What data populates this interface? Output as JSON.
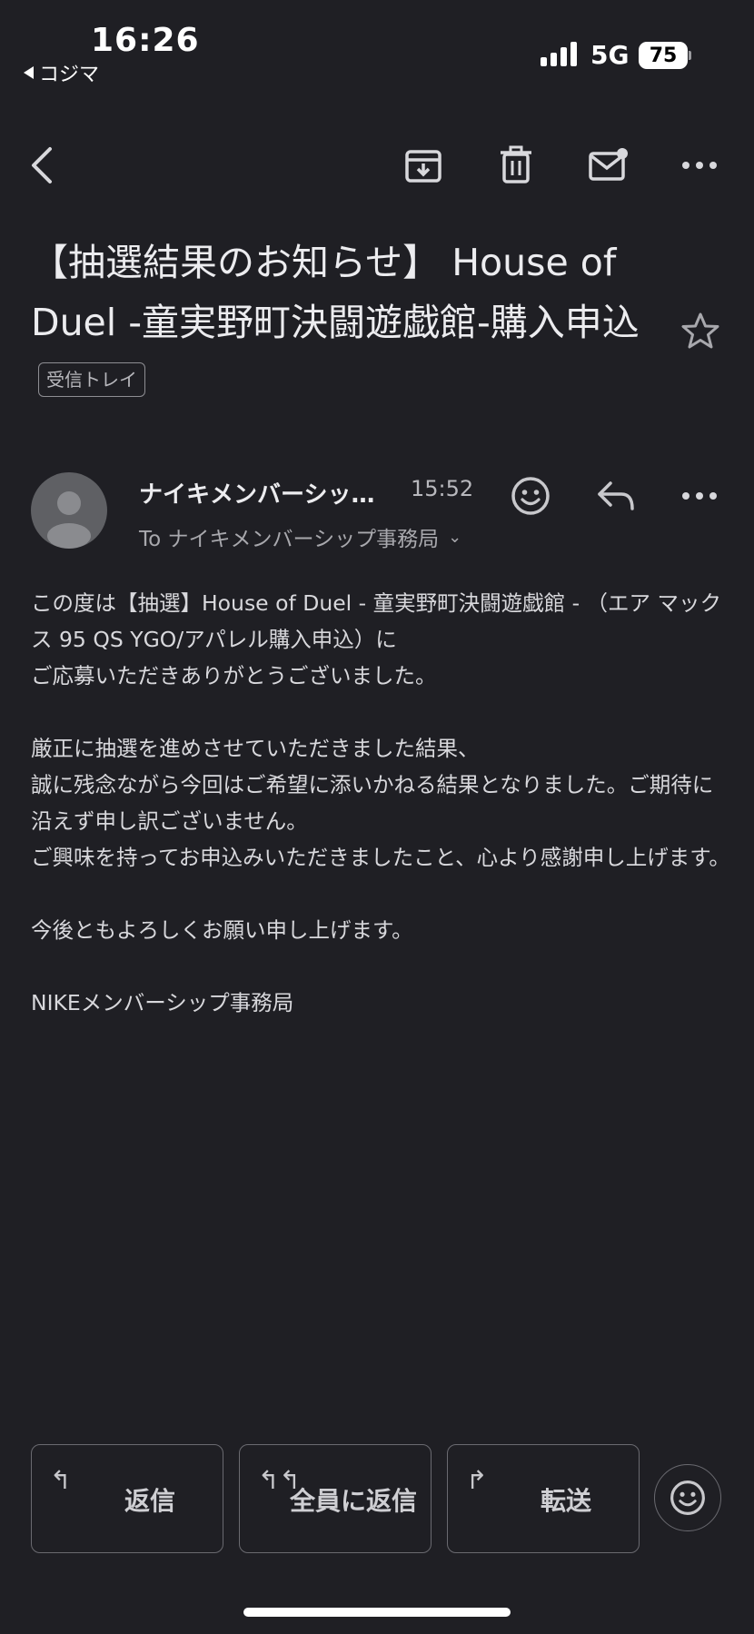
{
  "status_bar": {
    "time": "16:26",
    "back_app": "コジマ",
    "network": "5G",
    "battery": "75"
  },
  "toolbar": {
    "icons": [
      "back-arrow",
      "archive-icon",
      "trash-icon",
      "mark-unread-icon",
      "more-icon"
    ]
  },
  "email": {
    "subject": "【抽選結果のお知らせ】 House of Duel -童実野町決闘遊戯館-購入申込",
    "label": "受信トレイ",
    "sender_name": "ナイキメンバーシップ事務局",
    "time": "15:52",
    "to": "To ナイキメンバーシップ事務局",
    "body": [
      "この度は【抽選】House of Duel - 童実野町決闘遊戯館 - （エア マックス 95 QS YGO/アパレル購入申込）に",
      "ご応募いただきありがとうございました。",
      "",
      "厳正に抽選を進めさせていただきました結果、",
      "誠に残念ながら今回はご希望に添いかねる結果となりました。ご期待に沿えず申し訳ございません。",
      "ご興味を持ってお申込みいただきましたこと、心より感謝申し上げます。",
      "",
      "今後ともよろしくお願い申し上げます。",
      "",
      "NIKEメンバーシップ事務局"
    ]
  },
  "actions": {
    "reply": "返信",
    "reply_all": "全員に返信",
    "forward": "転送"
  },
  "colors": {
    "background": "#1f1f24",
    "text": "#ececef",
    "muted": "#a8a8ad"
  }
}
